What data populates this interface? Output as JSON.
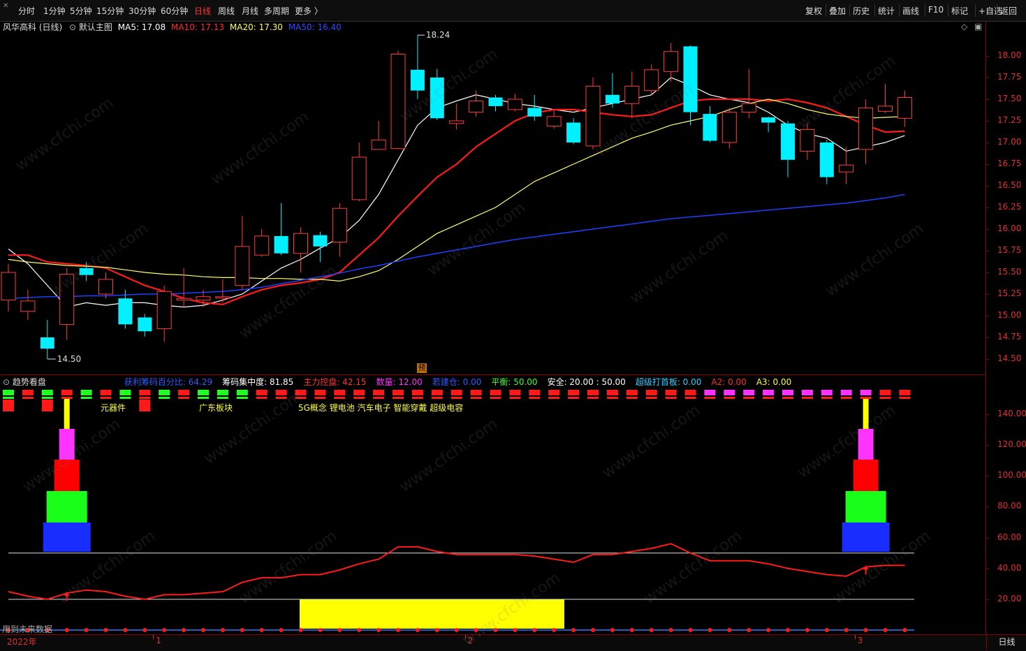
{
  "toolbar": {
    "periods": [
      "分时",
      "1分钟",
      "5分钟",
      "15分钟",
      "30分钟",
      "60分钟",
      "日线",
      "周线",
      "月线",
      "多周期",
      "更多 〉"
    ],
    "active_period": "日线",
    "right_buttons": [
      "复权",
      "叠加",
      "历史",
      "统计",
      "画线",
      "F10",
      "标记",
      "+自选",
      "返回"
    ]
  },
  "main_chart": {
    "stock_name": "风华高科 (日线)",
    "indicator_label": "默认主图",
    "ma5": "MA5: 17.08",
    "ma10": "MA10: 17.13",
    "ma20": "MA20: 17.30",
    "ma50": "MA50: 16.40",
    "high_label": "18.24",
    "low_label": "14.50",
    "forecast_badge": "预",
    "colors": {
      "up": "#ff3b3b",
      "down": "#00f0ff",
      "ma5": "#ffffff",
      "ma10": "#ff1a1a",
      "ma20": "#ffff66",
      "ma50": "#1f3fff"
    }
  },
  "chart_data": [
    {
      "type": "candlestick",
      "title": "风华高科 (日线)",
      "y_ticks": [
        18.0,
        17.75,
        17.5,
        17.25,
        17.0,
        16.75,
        16.5,
        16.25,
        16.0,
        15.75,
        15.5,
        15.25,
        15.0,
        14.75,
        14.5
      ],
      "ylim": [
        14.35,
        18.3
      ],
      "candles": [
        {
          "o": 15.18,
          "c": 15.5,
          "h": 15.6,
          "l": 15.05
        },
        {
          "o": 15.05,
          "c": 15.17,
          "h": 15.3,
          "l": 14.95
        },
        {
          "o": 14.75,
          "c": 14.62,
          "h": 14.95,
          "l": 14.5
        },
        {
          "o": 14.9,
          "c": 15.48,
          "h": 15.55,
          "l": 14.72
        },
        {
          "o": 15.55,
          "c": 15.47,
          "h": 15.62,
          "l": 15.4
        },
        {
          "o": 15.25,
          "c": 15.42,
          "h": 15.5,
          "l": 15.2
        },
        {
          "o": 15.2,
          "c": 14.9,
          "h": 15.3,
          "l": 14.85
        },
        {
          "o": 14.98,
          "c": 14.82,
          "h": 15.02,
          "l": 14.76
        },
        {
          "o": 14.85,
          "c": 15.28,
          "h": 15.35,
          "l": 14.7
        },
        {
          "o": 15.18,
          "c": 15.2,
          "h": 15.55,
          "l": 15.1
        },
        {
          "o": 15.18,
          "c": 15.22,
          "h": 15.3,
          "l": 15.1
        },
        {
          "o": 15.22,
          "c": 15.22,
          "h": 15.42,
          "l": 15.15
        },
        {
          "o": 15.35,
          "c": 15.8,
          "h": 16.15,
          "l": 15.3
        },
        {
          "o": 15.7,
          "c": 15.92,
          "h": 16.0,
          "l": 15.68
        },
        {
          "o": 15.92,
          "c": 15.72,
          "h": 16.3,
          "l": 15.7
        },
        {
          "o": 15.72,
          "c": 15.95,
          "h": 16.02,
          "l": 15.5
        },
        {
          "o": 15.93,
          "c": 15.8,
          "h": 15.97,
          "l": 15.62
        },
        {
          "o": 15.85,
          "c": 16.24,
          "h": 16.3,
          "l": 15.68
        },
        {
          "o": 16.34,
          "c": 16.83,
          "h": 17.0,
          "l": 16.32
        },
        {
          "o": 16.92,
          "c": 17.03,
          "h": 17.25,
          "l": 16.92
        },
        {
          "o": 16.93,
          "c": 18.02,
          "h": 18.06,
          "l": 16.92
        },
        {
          "o": 17.84,
          "c": 17.6,
          "h": 18.24,
          "l": 17.5
        },
        {
          "o": 17.75,
          "c": 17.28,
          "h": 17.85,
          "l": 17.26
        },
        {
          "o": 17.22,
          "c": 17.25,
          "h": 17.45,
          "l": 17.15
        },
        {
          "o": 17.35,
          "c": 17.48,
          "h": 17.6,
          "l": 17.3
        },
        {
          "o": 17.52,
          "c": 17.42,
          "h": 17.55,
          "l": 17.36
        },
        {
          "o": 17.38,
          "c": 17.5,
          "h": 17.56,
          "l": 17.36
        },
        {
          "o": 17.4,
          "c": 17.3,
          "h": 17.55,
          "l": 17.25
        },
        {
          "o": 17.19,
          "c": 17.3,
          "h": 17.38,
          "l": 17.16
        },
        {
          "o": 17.23,
          "c": 17.0,
          "h": 17.28,
          "l": 16.98
        },
        {
          "o": 16.96,
          "c": 17.65,
          "h": 17.75,
          "l": 16.92
        },
        {
          "o": 17.55,
          "c": 17.45,
          "h": 17.8,
          "l": 17.4
        },
        {
          "o": 17.45,
          "c": 17.65,
          "h": 17.82,
          "l": 17.28
        },
        {
          "o": 17.6,
          "c": 17.84,
          "h": 17.9,
          "l": 17.55
        },
        {
          "o": 17.82,
          "c": 18.05,
          "h": 18.15,
          "l": 17.7
        },
        {
          "o": 18.11,
          "c": 17.35,
          "h": 18.12,
          "l": 17.2
        },
        {
          "o": 17.33,
          "c": 17.02,
          "h": 17.42,
          "l": 17.0
        },
        {
          "o": 17.0,
          "c": 17.35,
          "h": 17.4,
          "l": 16.93
        },
        {
          "o": 17.35,
          "c": 17.45,
          "h": 17.85,
          "l": 17.28
        },
        {
          "o": 17.29,
          "c": 17.23,
          "h": 17.3,
          "l": 17.12
        },
        {
          "o": 17.22,
          "c": 16.8,
          "h": 17.25,
          "l": 16.6
        },
        {
          "o": 16.9,
          "c": 17.15,
          "h": 17.22,
          "l": 16.8
        },
        {
          "o": 17.0,
          "c": 16.6,
          "h": 17.03,
          "l": 16.52
        },
        {
          "o": 16.66,
          "c": 16.74,
          "h": 16.95,
          "l": 16.52
        },
        {
          "o": 16.92,
          "c": 17.4,
          "h": 17.5,
          "l": 16.75
        },
        {
          "o": 17.36,
          "c": 17.42,
          "h": 17.68,
          "l": 17.34
        },
        {
          "o": 17.28,
          "c": 17.52,
          "h": 17.6,
          "l": 17.18
        }
      ],
      "series": [
        {
          "name": "MA5",
          "values": [
            15.77,
            15.6,
            15.35,
            15.1,
            15.15,
            15.12,
            15.15,
            15.15,
            15.12,
            15.1,
            15.12,
            15.18,
            15.25,
            15.4,
            15.55,
            15.65,
            15.78,
            15.9,
            16.1,
            16.4,
            16.8,
            17.2,
            17.4,
            17.48,
            17.55,
            17.5,
            17.45,
            17.42,
            17.38,
            17.35,
            17.4,
            17.45,
            17.5,
            17.55,
            17.75,
            17.66,
            17.55,
            17.5,
            17.46,
            17.35,
            17.2,
            17.1,
            17.05,
            16.9,
            16.95,
            17.0,
            17.08
          ]
        },
        {
          "name": "MA10",
          "values": [
            15.7,
            15.7,
            15.62,
            15.6,
            15.58,
            15.55,
            15.45,
            15.35,
            15.28,
            15.2,
            15.15,
            15.13,
            15.22,
            15.3,
            15.35,
            15.38,
            15.42,
            15.5,
            15.7,
            15.9,
            16.15,
            16.38,
            16.6,
            16.75,
            16.95,
            17.1,
            17.25,
            17.34,
            17.38,
            17.38,
            17.35,
            17.32,
            17.3,
            17.32,
            17.4,
            17.48,
            17.5,
            17.5,
            17.5,
            17.48,
            17.5,
            17.46,
            17.4,
            17.3,
            17.2,
            17.12,
            17.13
          ]
        },
        {
          "name": "MA20",
          "values": [
            15.65,
            15.62,
            15.6,
            15.58,
            15.57,
            15.56,
            15.53,
            15.5,
            15.48,
            15.47,
            15.45,
            15.44,
            15.44,
            15.43,
            15.43,
            15.42,
            15.42,
            15.4,
            15.45,
            15.52,
            15.65,
            15.8,
            15.95,
            16.05,
            16.15,
            16.25,
            16.4,
            16.55,
            16.65,
            16.75,
            16.85,
            16.95,
            17.05,
            17.12,
            17.2,
            17.25,
            17.3,
            17.38,
            17.45,
            17.5,
            17.45,
            17.38,
            17.33,
            17.3,
            17.28,
            17.29,
            17.3
          ]
        },
        {
          "name": "MA50",
          "values": [
            15.2,
            15.21,
            15.22,
            15.22,
            15.23,
            15.23,
            15.24,
            15.25,
            15.25,
            15.26,
            15.27,
            15.28,
            15.3,
            15.33,
            15.37,
            15.41,
            15.45,
            15.49,
            15.54,
            15.58,
            15.63,
            15.68,
            15.72,
            15.76,
            15.8,
            15.84,
            15.88,
            15.91,
            15.94,
            15.97,
            16.0,
            16.03,
            16.06,
            16.09,
            16.12,
            16.14,
            16.16,
            16.18,
            16.2,
            16.22,
            16.24,
            16.26,
            16.28,
            16.3,
            16.33,
            16.36,
            16.4
          ]
        }
      ]
    },
    {
      "type": "line",
      "title": "趋势看盘",
      "y_ticks": [
        140.0,
        120.0,
        100.0,
        80.0,
        60.0,
        40.0,
        20.0
      ],
      "ylim": [
        0,
        152
      ],
      "series": [
        {
          "name": "筹码集中度",
          "values": [
            25,
            22,
            20,
            24,
            26,
            25,
            22,
            20,
            23,
            23,
            24,
            25,
            31,
            34,
            34,
            36,
            36,
            39,
            43,
            46,
            54,
            54,
            51,
            49,
            49,
            49,
            49,
            48,
            46,
            44,
            49,
            49,
            51,
            53,
            56,
            50,
            45,
            45,
            45,
            43,
            40,
            38,
            36,
            35,
            41,
            42,
            42
          ]
        }
      ],
      "reference_lines": [
        50,
        20
      ]
    }
  ],
  "indicator_panel": {
    "title": "趋势看盘",
    "fields": [
      {
        "text": "获利筹码百分比: 64.29",
        "color": "#2d5bff"
      },
      {
        "text": "筹码集中度: 81.85",
        "color": "#ffffff"
      },
      {
        "text": "主力控盘: 42.15",
        "color": "#ff3030"
      },
      {
        "text": "数量: 12.00",
        "color": "#ff33ff"
      },
      {
        "text": "若建仓: 0.00",
        "color": "#2d5bff"
      },
      {
        "text": "平衡: 50.00",
        "color": "#33ff33"
      },
      {
        "text": "安全: 20.00 : 50.00",
        "color": "#ffffff"
      },
      {
        "text": "超级打首板: 0.00",
        "color": "#33ccff"
      },
      {
        "text": "A2: 0.00",
        "color": "#ff3030"
      },
      {
        "text": "A3: 0.00",
        "color": "#ffff33"
      }
    ],
    "sector_tags": [
      "元器件",
      "广东板块",
      "5G概念 锂电池 汽车电子 智能穿戴 超级电容"
    ],
    "status_text": "用到未来数据",
    "top_strip_colors": [
      "g",
      "r",
      "g",
      "r",
      "g",
      "r",
      "g",
      "r",
      "g",
      "r",
      "g",
      "g",
      "g",
      "r",
      "r",
      "r",
      "r",
      "r",
      "r",
      "r",
      "r",
      "r",
      "r",
      "r",
      "r",
      "r",
      "r",
      "r",
      "r",
      "r",
      "r",
      "r",
      "r",
      "r",
      "r",
      "r",
      "m",
      "m",
      "m",
      "m",
      "m",
      "m",
      "m",
      "m",
      "m",
      "r",
      "r"
    ]
  },
  "x_axis": {
    "labels": [
      {
        "text": "2022年",
        "idx": 0
      },
      {
        "text": "1",
        "idx": 8
      },
      {
        "text": "2",
        "idx": 24
      },
      {
        "text": "3",
        "idx": 44
      }
    ],
    "period_button": "日线"
  }
}
